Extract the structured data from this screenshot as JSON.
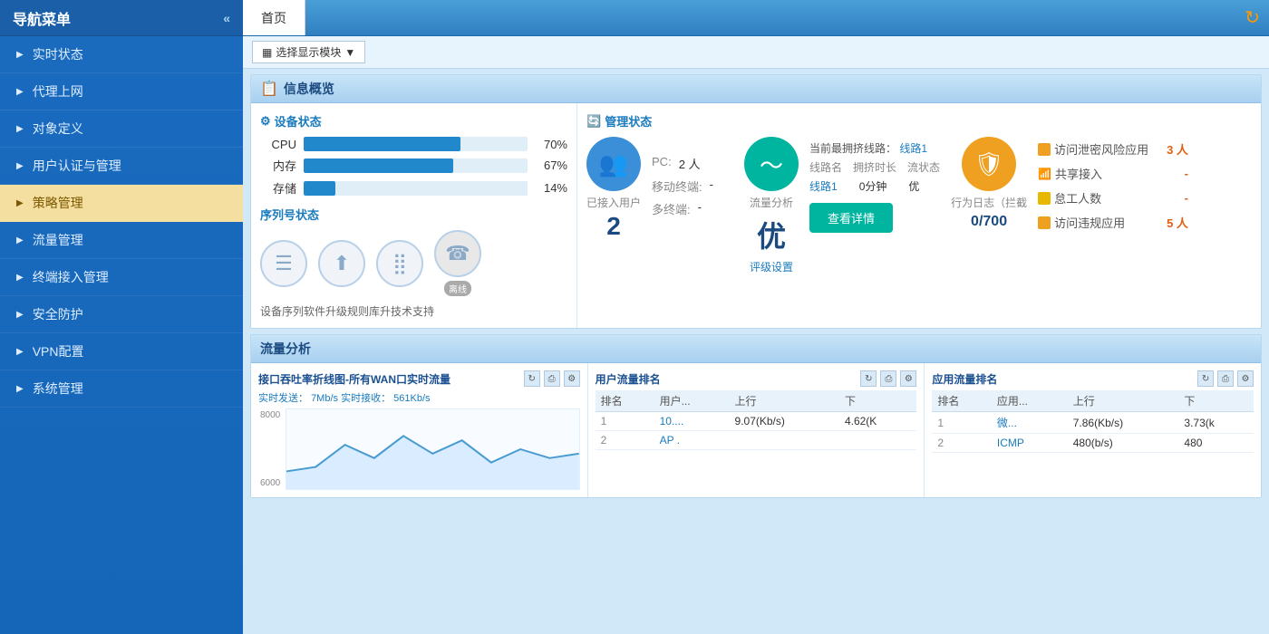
{
  "sidebar": {
    "title": "导航菜单",
    "collapse_label": "«",
    "items": [
      {
        "id": "realtime",
        "label": "实时状态",
        "active": false
      },
      {
        "id": "proxy",
        "label": "代理上网",
        "active": false
      },
      {
        "id": "objects",
        "label": "对象定义",
        "active": false
      },
      {
        "id": "auth",
        "label": "用户认证与管理",
        "active": false
      },
      {
        "id": "policy",
        "label": "策略管理",
        "active": true
      },
      {
        "id": "flow",
        "label": "流量管理",
        "active": false
      },
      {
        "id": "terminal",
        "label": "终端接入管理",
        "active": false
      },
      {
        "id": "security",
        "label": "安全防护",
        "active": false
      },
      {
        "id": "vpn",
        "label": "VPN配置",
        "active": false
      },
      {
        "id": "sysadmin",
        "label": "系统管理",
        "active": false
      }
    ]
  },
  "topbar": {
    "tab_label": "首页",
    "refresh_icon": "↻"
  },
  "toolbar": {
    "select_module_label": "选择显示模块",
    "dropdown_icon": "▼"
  },
  "info_overview": {
    "section_title": "信息概览",
    "device_panel": {
      "title": "设备状态",
      "resources": [
        {
          "label": "CPU",
          "pct": 70,
          "pct_label": "70%"
        },
        {
          "label": "内存",
          "pct": 67,
          "pct_label": "67%"
        },
        {
          "label": "存储",
          "pct": 14,
          "pct_label": "14%"
        }
      ],
      "serial_title": "序列号状态",
      "serial_icons": [
        {
          "icon": "☰",
          "label": ""
        },
        {
          "icon": "⬆",
          "label": ""
        },
        {
          "icon": "⣿",
          "label": ""
        },
        {
          "icon": "☎",
          "label": "离线",
          "offline": true
        }
      ],
      "serial_desc": "设备序列软件升级规则库升技术支持"
    },
    "management_panel": {
      "title": "管理状态",
      "connected_users_label": "已接入用户",
      "connected_users_value": "2",
      "flow_analysis_label": "流量分析",
      "flow_quality": "优",
      "rating_label": "评级设置",
      "behavior_log_label": "行为日志（拦截",
      "behavior_log_value": "0/700",
      "pc_label": "PC:",
      "pc_value": "2 人",
      "mobile_label": "移动终端:",
      "mobile_value": "-",
      "multi_label": "多终端:",
      "multi_value": "-",
      "congestion_line_label": "当前最拥挤线路：",
      "congestion_line_value": "线路1",
      "route_name_label": "线路名",
      "congestion_time_label": "拥挤时长",
      "flow_status_label": "流状态",
      "route_name_value": "线路1",
      "congestion_time_value": "0分钟",
      "flow_status_value": "优",
      "access_risk_label": "访问泄密风险应用",
      "access_risk_value": "3 人",
      "shared_access_label": "共享接入",
      "shared_access_value": "-",
      "lazy_label": "怠工人数",
      "lazy_value": "-",
      "violation_label": "访问违规应用",
      "violation_value": "5 人",
      "detail_btn_label": "查看详情"
    }
  },
  "flow_analysis": {
    "section_title": "流量分析",
    "panels": [
      {
        "id": "wan",
        "title": "接口吞吐率折线图-所有WAN口实时流量",
        "stats_send_label": "实时发送：",
        "stats_send_value": "7Mb/s",
        "stats_recv_label": "实时接收：",
        "stats_recv_value": "561Kb/s",
        "y_values": [
          "8000",
          "6000"
        ],
        "chart_type": "line"
      },
      {
        "id": "user-flow",
        "title": "用户流量排名",
        "columns": [
          "排名",
          "用户...",
          "上行",
          "下行"
        ],
        "rows": [
          {
            "rank": "1",
            "name": "10....",
            "up": "9.07(Kb/s)",
            "down": "4.62(K"
          },
          {
            "rank": "2",
            "name": "AP .",
            "up": "",
            "down": ""
          }
        ]
      },
      {
        "id": "app-flow",
        "title": "应用流量排名",
        "columns": [
          "排名",
          "应用...",
          "上行",
          "下行"
        ],
        "rows": [
          {
            "rank": "1",
            "name": "微...",
            "up": "7.86(Kb/s)",
            "down": "3.73(k"
          },
          {
            "rank": "2",
            "name": "ICMP",
            "up": "480(b/s)",
            "down": "480"
          }
        ]
      }
    ]
  }
}
